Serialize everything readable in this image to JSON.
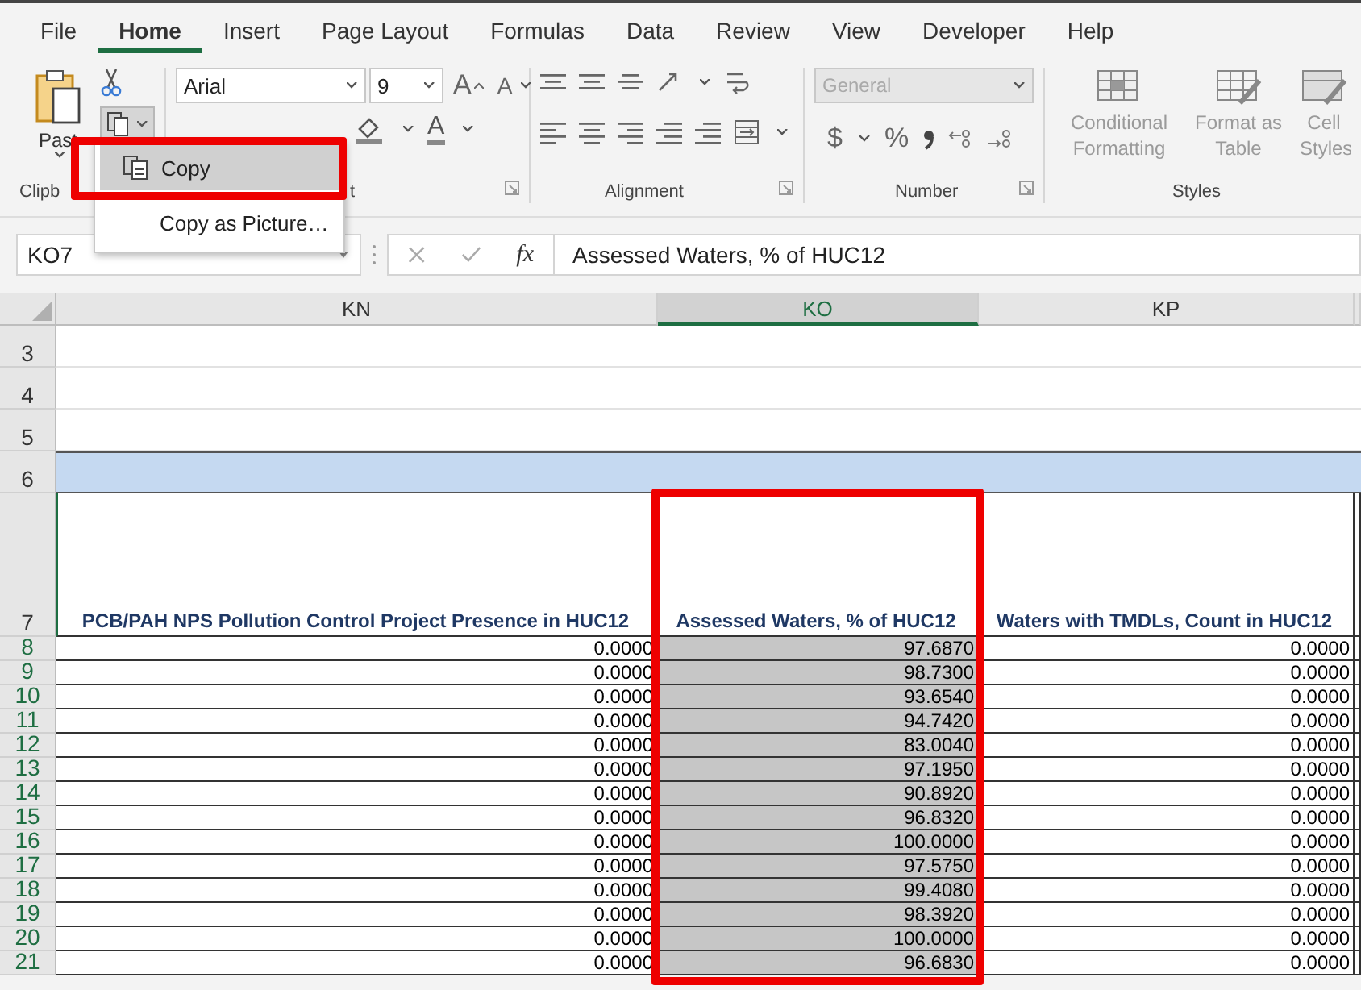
{
  "ribbon": {
    "tabs": [
      {
        "label": "File",
        "selected": false
      },
      {
        "label": "Home",
        "selected": true
      },
      {
        "label": "Insert",
        "selected": false
      },
      {
        "label": "Page Layout",
        "selected": false
      },
      {
        "label": "Formulas",
        "selected": false
      },
      {
        "label": "Data",
        "selected": false
      },
      {
        "label": "Review",
        "selected": false
      },
      {
        "label": "View",
        "selected": false
      },
      {
        "label": "Developer",
        "selected": false
      },
      {
        "label": "Help",
        "selected": false
      }
    ],
    "clipboard": {
      "paste_label": "Past",
      "group_label": "Clipb"
    },
    "font": {
      "name": "Arial",
      "size": "9",
      "grow": "A",
      "shrink": "A",
      "fill_color_letter": "A",
      "group_label": "t"
    },
    "alignment": {
      "group_label": "Alignment"
    },
    "number": {
      "format": "General",
      "currency": "$",
      "percent": "%",
      "group_label": "Number"
    },
    "styles": {
      "buttons": [
        "Conditional Formatting",
        "Format as Table",
        "Cell Styles"
      ],
      "group_label": "Styles"
    }
  },
  "copy_menu": {
    "items": [
      {
        "label": "Copy",
        "selected": true
      },
      {
        "label": "Copy as Picture…",
        "selected": false
      }
    ]
  },
  "formula_bar": {
    "name_box": "KO7",
    "function_label": "fx",
    "formula": "Assessed Waters, % of HUC12"
  },
  "sheet": {
    "columns": [
      {
        "label": "KN",
        "selected": false
      },
      {
        "label": "KO",
        "selected": true
      },
      {
        "label": "KP",
        "selected": false
      }
    ],
    "rows": [
      {
        "number": "3",
        "kind": "blank",
        "selected": false
      },
      {
        "number": "4",
        "kind": "blank",
        "selected": false
      },
      {
        "number": "5",
        "kind": "blank",
        "selected": false
      },
      {
        "number": "6",
        "kind": "band",
        "selected": false
      },
      {
        "number": "7",
        "kind": "header",
        "selected": false,
        "cells": [
          "PCB/PAH NPS Pollution Control Project Presence in HUC12",
          "Assessed Waters, % of HUC12",
          "Waters with TMDLs, Count in HUC12"
        ]
      },
      {
        "number": "8",
        "kind": "data",
        "selected": true,
        "cells": [
          "0.0000",
          "97.6870",
          "0.0000"
        ]
      },
      {
        "number": "9",
        "kind": "data",
        "selected": true,
        "cells": [
          "0.0000",
          "98.7300",
          "0.0000"
        ]
      },
      {
        "number": "10",
        "kind": "data",
        "selected": true,
        "cells": [
          "0.0000",
          "93.6540",
          "0.0000"
        ]
      },
      {
        "number": "11",
        "kind": "data",
        "selected": true,
        "cells": [
          "0.0000",
          "94.7420",
          "0.0000"
        ]
      },
      {
        "number": "12",
        "kind": "data",
        "selected": true,
        "cells": [
          "0.0000",
          "83.0040",
          "0.0000"
        ]
      },
      {
        "number": "13",
        "kind": "data",
        "selected": true,
        "cells": [
          "0.0000",
          "97.1950",
          "0.0000"
        ]
      },
      {
        "number": "14",
        "kind": "data",
        "selected": true,
        "cells": [
          "0.0000",
          "90.8920",
          "0.0000"
        ]
      },
      {
        "number": "15",
        "kind": "data",
        "selected": true,
        "cells": [
          "0.0000",
          "96.8320",
          "0.0000"
        ]
      },
      {
        "number": "16",
        "kind": "data",
        "selected": true,
        "cells": [
          "0.0000",
          "100.0000",
          "0.0000"
        ]
      },
      {
        "number": "17",
        "kind": "data",
        "selected": true,
        "cells": [
          "0.0000",
          "97.5750",
          "0.0000"
        ]
      },
      {
        "number": "18",
        "kind": "data",
        "selected": true,
        "cells": [
          "0.0000",
          "99.4080",
          "0.0000"
        ]
      },
      {
        "number": "19",
        "kind": "data",
        "selected": true,
        "cells": [
          "0.0000",
          "98.3920",
          "0.0000"
        ]
      },
      {
        "number": "20",
        "kind": "data",
        "selected": true,
        "cells": [
          "0.0000",
          "100.0000",
          "0.0000"
        ]
      },
      {
        "number": "21",
        "kind": "data",
        "selected": true,
        "cells": [
          "0.0000",
          "96.6830",
          "0.0000"
        ]
      }
    ]
  }
}
